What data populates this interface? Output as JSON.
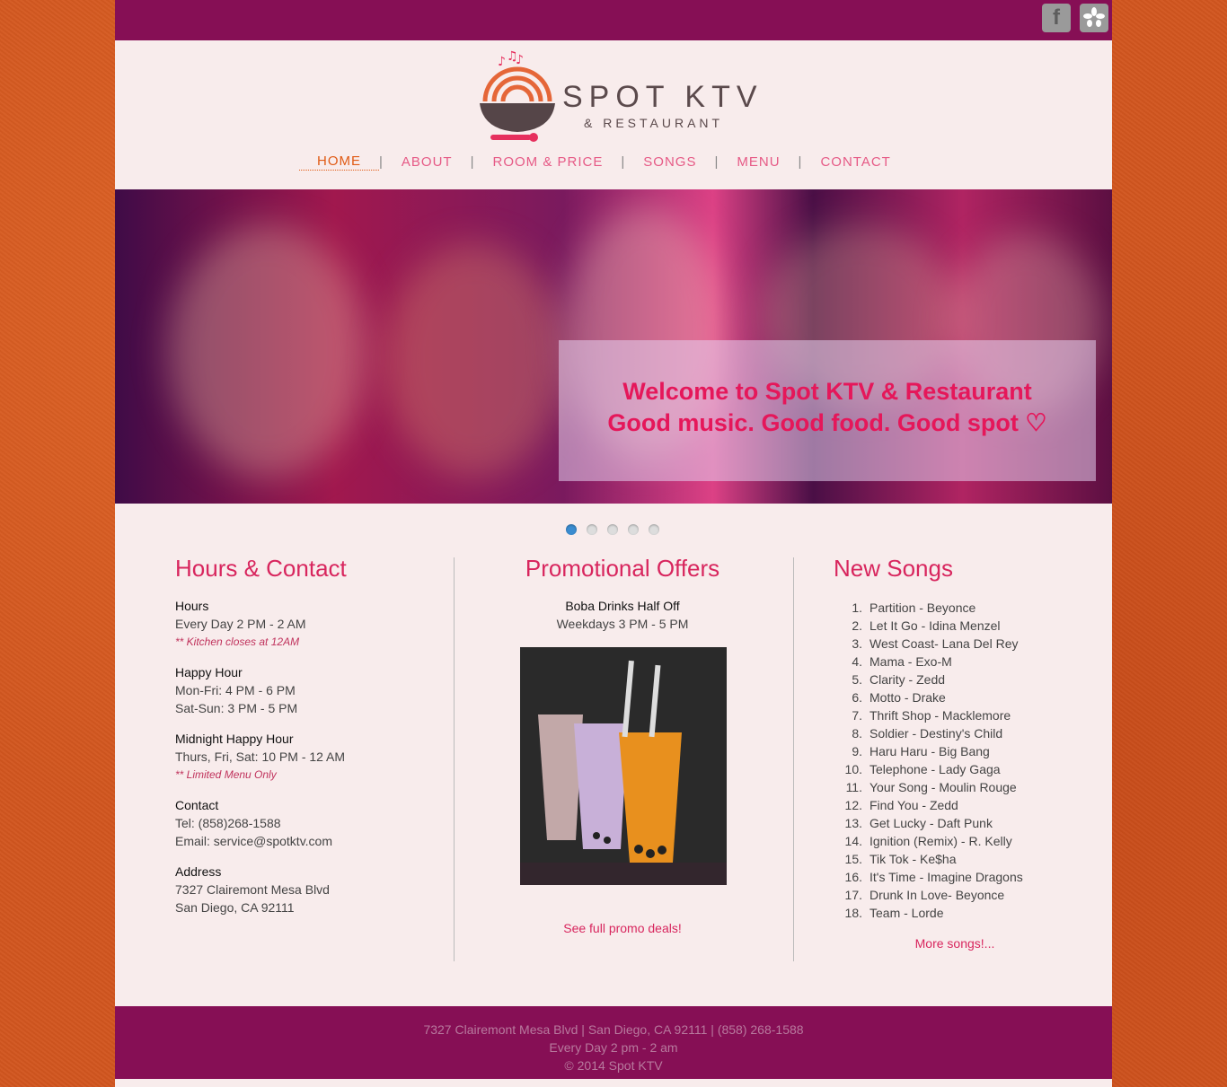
{
  "social": {
    "facebook": "f",
    "yelp": "yelp"
  },
  "brand": {
    "name": "SPOT KTV",
    "sub": "& RESTAURANT"
  },
  "nav": {
    "home": "HOME",
    "about": "ABOUT",
    "room": "ROOM & PRICE",
    "songs": "SONGS",
    "menu": "MENU",
    "contact": "CONTACT",
    "sep": "|"
  },
  "hero": {
    "line1": "Welcome to Spot KTV & Restaurant",
    "line2": "Good music. Good food. Good spot ♡"
  },
  "hours": {
    "title": "Hours & Contact",
    "hours_label": "Hours",
    "hours_value": "Every Day 2 PM - 2 AM",
    "hours_note": "** Kitchen closes at 12AM",
    "happy_label": "Happy Hour",
    "happy_1": "Mon-Fri: 4 PM - 6 PM",
    "happy_2": "Sat-Sun: 3 PM - 5 PM",
    "midnight_label": "Midnight Happy Hour",
    "midnight_value": "Thurs, Fri, Sat: 10 PM - 12 AM",
    "midnight_note": "** Limited Menu Only",
    "contact_label": "Contact",
    "tel": "Tel: (858)268-1588",
    "email": "Email: service@spotktv.com",
    "address_label": "Address",
    "address_1": "7327 Clairemont Mesa Blvd",
    "address_2": "San Diego, CA 92111"
  },
  "promo": {
    "title": "Promotional Offers",
    "offer": "Boba Drinks Half Off",
    "time": "Weekdays 3 PM - 5 PM",
    "link": "See full promo deals!"
  },
  "songs": {
    "title": "New Songs",
    "items": [
      "Partition - Beyonce",
      "Let It Go - Idina Menzel",
      "West Coast- Lana Del Rey",
      "Mama - Exo-M",
      "Clarity - Zedd",
      "Motto - Drake",
      "Thrift Shop - Macklemore",
      "Soldier - Destiny's Child",
      "Haru Haru - Big Bang",
      "Telephone - Lady Gaga",
      "Your Song - Moulin Rouge",
      "Find You - Zedd",
      "Get Lucky - Daft Punk",
      "Ignition (Remix) - R. Kelly",
      "Tik Tok - Ke$ha",
      "It's Time - Imagine Dragons",
      "Drunk In Love- Beyonce",
      "Team - Lorde"
    ],
    "more": "More songs!..."
  },
  "footer": {
    "line1": "7327 Clairemont Mesa Blvd | San Diego, CA 92111 | (858) 268-1588",
    "line2": "Every Day 2 pm - 2 am",
    "line3": "© 2014 Spot KTV"
  },
  "colors": {
    "brand": "#860f55",
    "accent": "#d8265e",
    "nav_active": "#e05a14",
    "background": "#d2561f"
  }
}
